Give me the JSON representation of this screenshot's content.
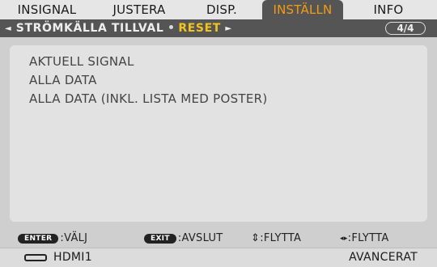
{
  "tabs": [
    {
      "label": "INSIGNAL"
    },
    {
      "label": "JUSTERA"
    },
    {
      "label": "DISP."
    },
    {
      "label": "INSTÄLLN",
      "active": true
    },
    {
      "label": "INFO"
    }
  ],
  "subbar": {
    "left_arrow": "◄",
    "previous": "STRÖMKÄLLA TILLVAL",
    "current": "RESET",
    "right_arrow": "►",
    "page": "4/4"
  },
  "items": [
    {
      "label": "AKTUELL SIGNAL"
    },
    {
      "label": "ALLA DATA"
    },
    {
      "label": "ALLA DATA (INKL. LISTA MED POSTER)"
    }
  ],
  "hints": {
    "enter_key": "ENTER",
    "enter_label": ":VÄLJ",
    "exit_key": "EXIT",
    "exit_label": ":AVSLUT",
    "updown_icon": "⇕",
    "updown_label": ":FLYTTA",
    "leftright_icon": "◂▸",
    "leftright_label": ":FLYTTA"
  },
  "status": {
    "input_icon": "hdmi-icon",
    "input": "HDMI1",
    "mode": "AVANCERAT"
  },
  "colors": {
    "active_tab_text": "#f39c12",
    "reset_text": "#f3c31e",
    "bar_dark": "#555555"
  }
}
